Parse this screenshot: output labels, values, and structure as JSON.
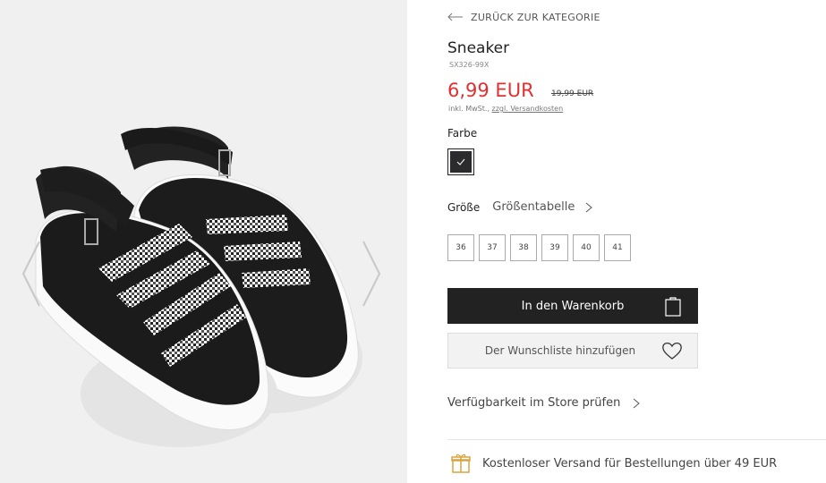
{
  "gallery": {
    "prev_icon": "chevron-left-icon",
    "next_icon": "chevron-right-icon"
  },
  "header": {
    "back_label": "ZURÜCK ZUR KATEGORIE"
  },
  "product": {
    "name": "Sneaker",
    "sku": "SX326-99X",
    "price": "6,99 EUR",
    "old_price": "19,99 EUR",
    "tax_text": "inkl. MwSt., ",
    "shipping_link": "zzgl. Versandkosten",
    "price_color": "#e03030"
  },
  "color": {
    "label": "Farbe",
    "selected_swatch": "#2b2b2d"
  },
  "size": {
    "label": "Größe",
    "table_link": "Größentabelle",
    "options": [
      "36",
      "37",
      "38",
      "39",
      "40",
      "41"
    ]
  },
  "actions": {
    "cart_label": "In den Warenkorb",
    "wishlist_label": "Der Wunschliste hinzufügen",
    "store_label": "Verfügbarkeit im Store prüfen"
  },
  "footer": {
    "shipping_text": "Kostenloser Versand für Bestellungen über 49 EUR",
    "shipping_icon": "gift-box-icon",
    "accent": "#d9a441"
  }
}
